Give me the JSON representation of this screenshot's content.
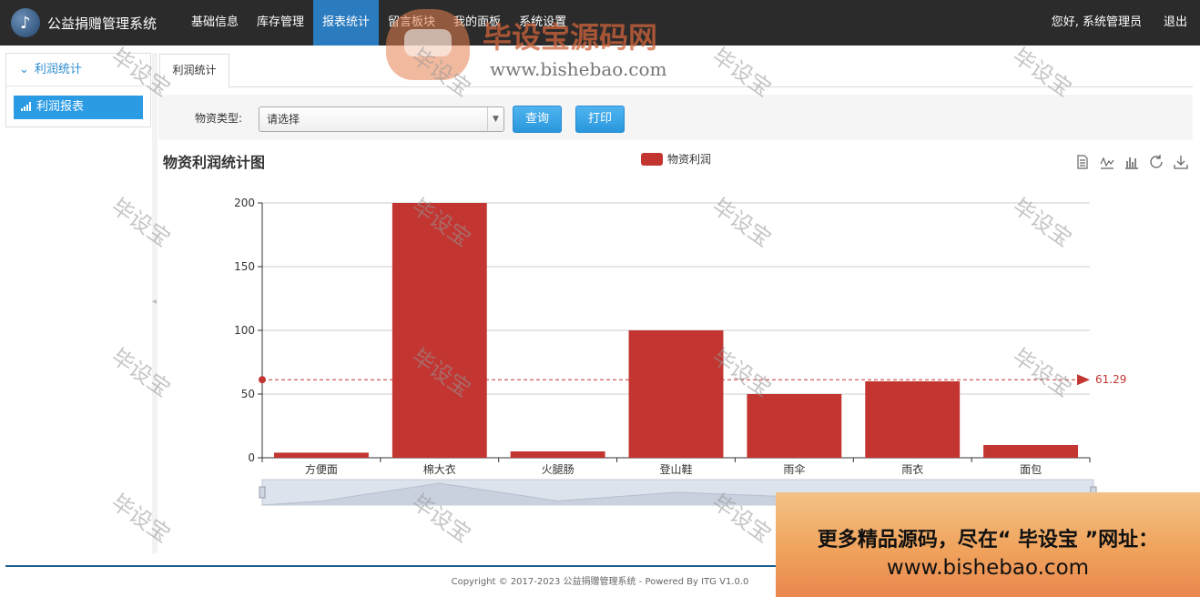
{
  "app": {
    "title": "公益捐赠管理系统"
  },
  "nav": {
    "items": [
      {
        "label": "基础信息"
      },
      {
        "label": "库存管理"
      },
      {
        "label": "报表统计",
        "active": true
      },
      {
        "label": "留言板块"
      },
      {
        "label": "我的面板"
      },
      {
        "label": "系统设置"
      }
    ],
    "greeting": "您好, 系统管理员",
    "logout": "退出"
  },
  "sidebar": {
    "section": "利润统计",
    "items": [
      {
        "label": "利润报表",
        "active": true
      }
    ]
  },
  "tabs": [
    {
      "label": "利润统计"
    }
  ],
  "query": {
    "label": "物资类型:",
    "select_value": "请选择",
    "search_button": "查询",
    "print_button": "打印"
  },
  "chart_data": {
    "type": "bar",
    "title": "物资利润统计图",
    "legend": [
      "物资利润"
    ],
    "categories": [
      "方便面",
      "棉大衣",
      "火腿肠",
      "登山鞋",
      "雨伞",
      "雨衣",
      "面包"
    ],
    "series": [
      {
        "name": "物资利润",
        "values": [
          4,
          200,
          5,
          100,
          50,
          60,
          10
        ],
        "color": "#c23531"
      }
    ],
    "ylim": [
      0,
      200
    ],
    "yticks": [
      0,
      50,
      100,
      150,
      200
    ],
    "mark_line": {
      "value": 61.29,
      "label": "61.29",
      "type": "average"
    },
    "grid": true,
    "legend_position": "top-center",
    "datazoom": true
  },
  "toolbox": [
    "data-view-icon",
    "line-chart-icon",
    "bar-chart-icon",
    "refresh-icon",
    "download-icon"
  ],
  "footer": {
    "text": "Copyright © 2017-2023 公益捐赠管理系统 - Powered By ITG V1.0.0"
  },
  "watermark": {
    "text": "毕设宝",
    "banner_title": "毕设宝源码网",
    "banner_url": "www.bishebao.com",
    "promo_line1": "更多精品源码，尽在“ 毕设宝 ”网址：",
    "promo_line2": "www.bishebao.com"
  }
}
